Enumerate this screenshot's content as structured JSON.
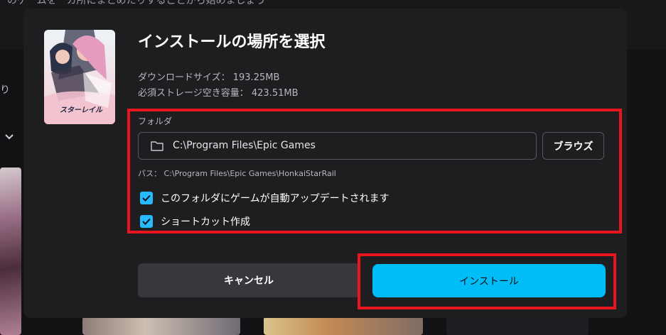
{
  "background": {
    "top_text": "のゲームを一カ所にまとめたりすることから始めましょう",
    "left_text": "り"
  },
  "dialog": {
    "title": "インストールの場所を選択",
    "download_size": "ダウンロードサイズ： 193.25MB",
    "required_space": "必須ストレージ空き容量： 423.51MB",
    "folder_label": "フォルダ",
    "folder_path": "C:\\Program Files\\Epic Games",
    "browse_label": "ブラウズ",
    "install_path": "パス： C:\\Program Files\\Epic Games\\HonkaiStarRail",
    "options": [
      {
        "label": "このフォルダにゲームが自動アップデートされます",
        "checked": true
      },
      {
        "label": "ショートカット作成",
        "checked": true
      }
    ],
    "cancel_label": "キャンセル",
    "install_label": "インストール",
    "game_logo_text": "スターレイル"
  },
  "icons": {
    "folder": "folder-icon",
    "checkmark": "checkmark-icon",
    "chevron": "chevron-down-icon"
  },
  "colors": {
    "accent": "#00bdf7",
    "checkbox": "#26bbff",
    "dialog_bg": "#1e1e21",
    "highlight": "#e8151f"
  }
}
